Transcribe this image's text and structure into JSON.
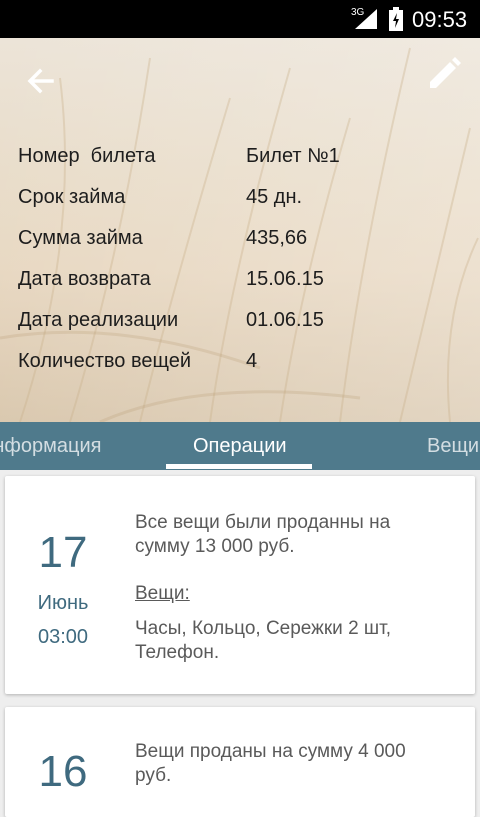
{
  "status_bar": {
    "network": "3G",
    "time": "09:53"
  },
  "header": {
    "rows": [
      {
        "label": "Номер  билета",
        "value": "Билет №1"
      },
      {
        "label": "Срок займа",
        "value": "45 дн."
      },
      {
        "label": "Сумма займа",
        "value": "435,66"
      },
      {
        "label": "Дата возврата",
        "value": "15.06.15"
      },
      {
        "label": "Дата реализации",
        "value": "01.06.15"
      },
      {
        "label": "Количество вещей",
        "value": "4"
      }
    ]
  },
  "tabs": [
    {
      "label": "Информация"
    },
    {
      "label": "Операции"
    },
    {
      "label": "Вещи"
    }
  ],
  "cards": [
    {
      "day": "17",
      "month": "Июнь",
      "time": "03:00",
      "description": "Все вещи были проданны на сумму 13 000 руб.",
      "items_label": "Вещи:",
      "items": "Часы, Кольцо, Сережки 2 шт, Телефон."
    },
    {
      "day": "16",
      "description": "Вещи проданы на сумму 4 000 руб."
    }
  ]
}
